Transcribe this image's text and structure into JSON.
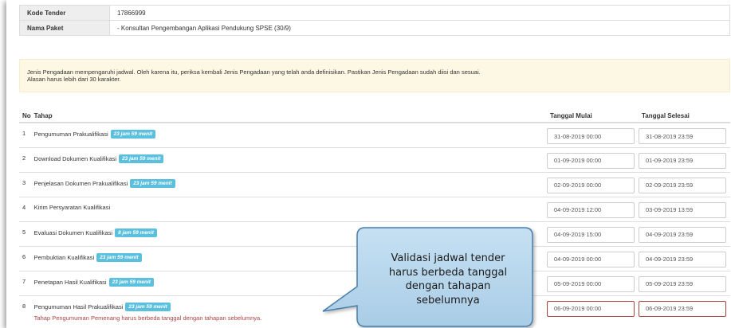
{
  "info": {
    "rows": [
      {
        "label": "Kode Tender",
        "value": "17866999"
      },
      {
        "label": "Nama Paket",
        "value": "- Konsultan Pengembangan Aplikasi Pendukung SPSE (30/9)"
      }
    ]
  },
  "warning": {
    "line1": "Jenis Pengadaan mempengaruhi jadwal. Oleh karena itu, periksa kembali Jenis Pengadaan yang telah anda definisikan. Pastikan Jenis Pengadaan sudah diisi dan sesuai.",
    "line2": "Alasan harus lebih dari 30 karakter."
  },
  "schedule": {
    "headers": {
      "no": "No",
      "tahap": "Tahap",
      "mulai": "Tanggal Mulai",
      "selesai": "Tanggal Selesai"
    },
    "rows": [
      {
        "no": "1",
        "tahap": "Pengumuman Prakualifikasi",
        "badge": "23 jam 59 menit",
        "mulai": "31-08-2019 00:00",
        "selesai": "31-08-2019 23:59"
      },
      {
        "no": "2",
        "tahap": "Download Dokumen Kualifikasi",
        "badge": "23 jam 59 menit",
        "mulai": "01-09-2019 00:00",
        "selesai": "01-09-2019 23:59"
      },
      {
        "no": "3",
        "tahap": "Penjelasan Dokumen Prakualifikasi",
        "badge": "23 jam 59 menit",
        "mulai": "02-09-2019 00:00",
        "selesai": "02-09-2019 23:59"
      },
      {
        "no": "4",
        "tahap": "Kirim Persyaratan Kualifikasi",
        "badge": "",
        "mulai": "04-09-2019 12:00",
        "selesai": "03-09-2019 13:59"
      },
      {
        "no": "5",
        "tahap": "Evaluasi Dokumen Kualifikasi",
        "badge": "8 jam 59 menit",
        "mulai": "04-09-2019 15:00",
        "selesai": "04-09-2019 23:59"
      },
      {
        "no": "6",
        "tahap": "Pembuktian Kualifikasi",
        "badge": "23 jam 59 menit",
        "mulai": "04-09-2019 00:00",
        "selesai": "04-09-2019 23:59"
      },
      {
        "no": "7",
        "tahap": "Penetapan Hasil Kualifikasi",
        "badge": "23 jam 59 menit",
        "mulai": "05-09-2019 00:00",
        "selesai": "05-09-2019 23:59"
      },
      {
        "no": "8",
        "tahap": "Pengumuman Hasil Prakualifikasi",
        "badge": "23 jam 59 menit",
        "mulai": "06-09-2019 00:00",
        "selesai": "06-09-2019 23:59",
        "error": "Tahap Pengumuman Pemenang harus berbeda tanggal dengan tahapan sebelumnya."
      }
    ]
  },
  "callout": {
    "line1": "Validasi jadwal tender",
    "line2": "harus berbeda tanggal",
    "line3": "dengan tahapan",
    "line4": "sebelumnya"
  },
  "colors": {
    "badge": "#5bc0de",
    "error": "#a94442",
    "warning_bg": "#fcf8e3",
    "callout_fill": "#a9cde6",
    "callout_stroke": "#4a7ea8"
  }
}
